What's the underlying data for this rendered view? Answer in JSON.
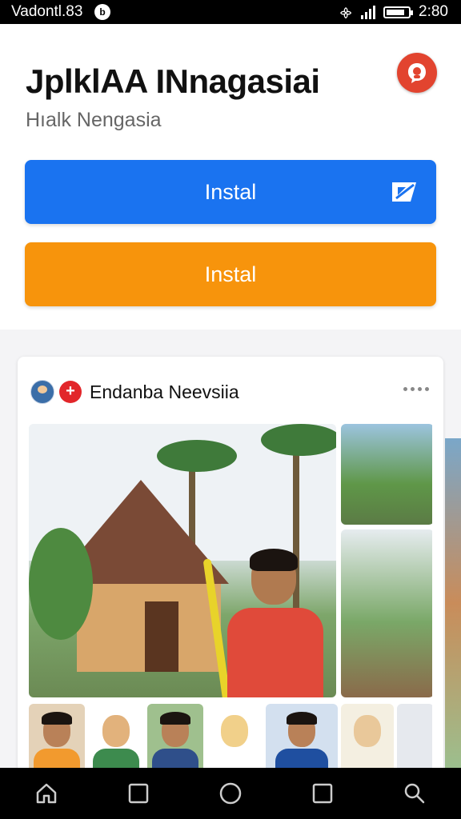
{
  "status_bar": {
    "carrier": "Vadontl.83",
    "time": "2:80"
  },
  "header": {
    "title": "JplklAA INnagasiai",
    "subtitle": "Hıalk Nengasia"
  },
  "buttons": {
    "primary_label": "Instal",
    "secondary_label": "Instal"
  },
  "card": {
    "name": "Endanba Neevsiia"
  },
  "colors": {
    "primary": "#1a73f0",
    "secondary": "#f7940c",
    "chat_badge": "#e2442f"
  },
  "icons": {
    "chat": "chat-bubble-icon",
    "send": "send-icon",
    "more": "more-horizontal-icon",
    "nav": [
      "home-icon",
      "square-icon",
      "circle-icon",
      "square-icon",
      "search-icon"
    ]
  }
}
